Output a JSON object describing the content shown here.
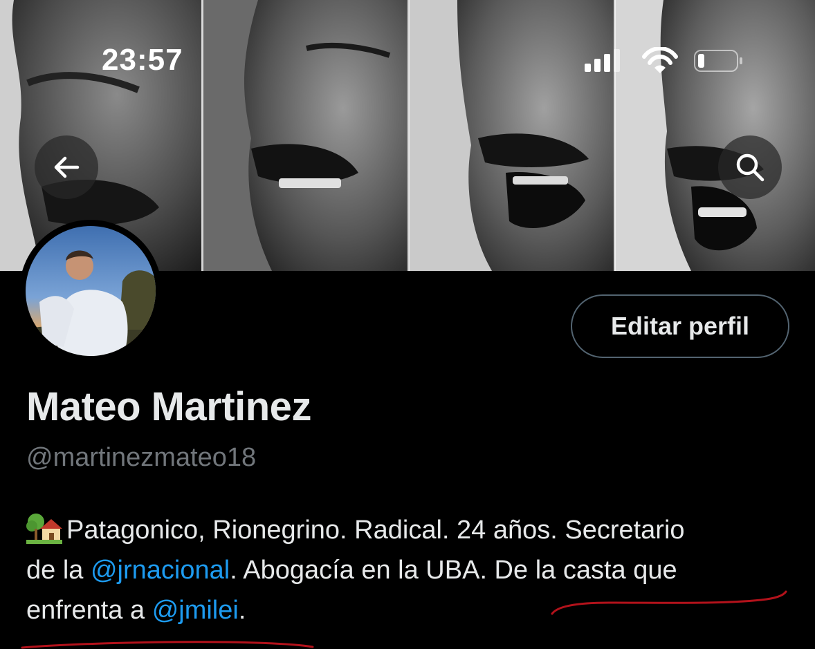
{
  "status_bar": {
    "time": "23:57",
    "icons": [
      "cellular-signal-icon",
      "wifi-icon",
      "battery-icon"
    ]
  },
  "header": {
    "back_icon": "arrow-left-icon",
    "search_icon": "search-icon"
  },
  "profile": {
    "edit_button_label": "Editar perfil",
    "display_name": "Mateo Martinez",
    "handle": "@martinezmateo18",
    "bio": {
      "emoji": "house-with-garden-icon",
      "line1": "Patagonico, Rionegrino. Radical. 24 años. Secretario",
      "line2_prefix": "de la ",
      "line2_mention": "@jrnacional",
      "line2_suffix": ". Abogacía en la UBA. De la casta que",
      "line3_prefix": "enfrenta a ",
      "line3_mention": "@jmilei",
      "line3_suffix": "."
    }
  },
  "colors": {
    "background": "#000000",
    "text": "#e7e9ea",
    "secondary_text": "#71767b",
    "link": "#1d9bf0",
    "annotation_underline": "#b3121b"
  }
}
